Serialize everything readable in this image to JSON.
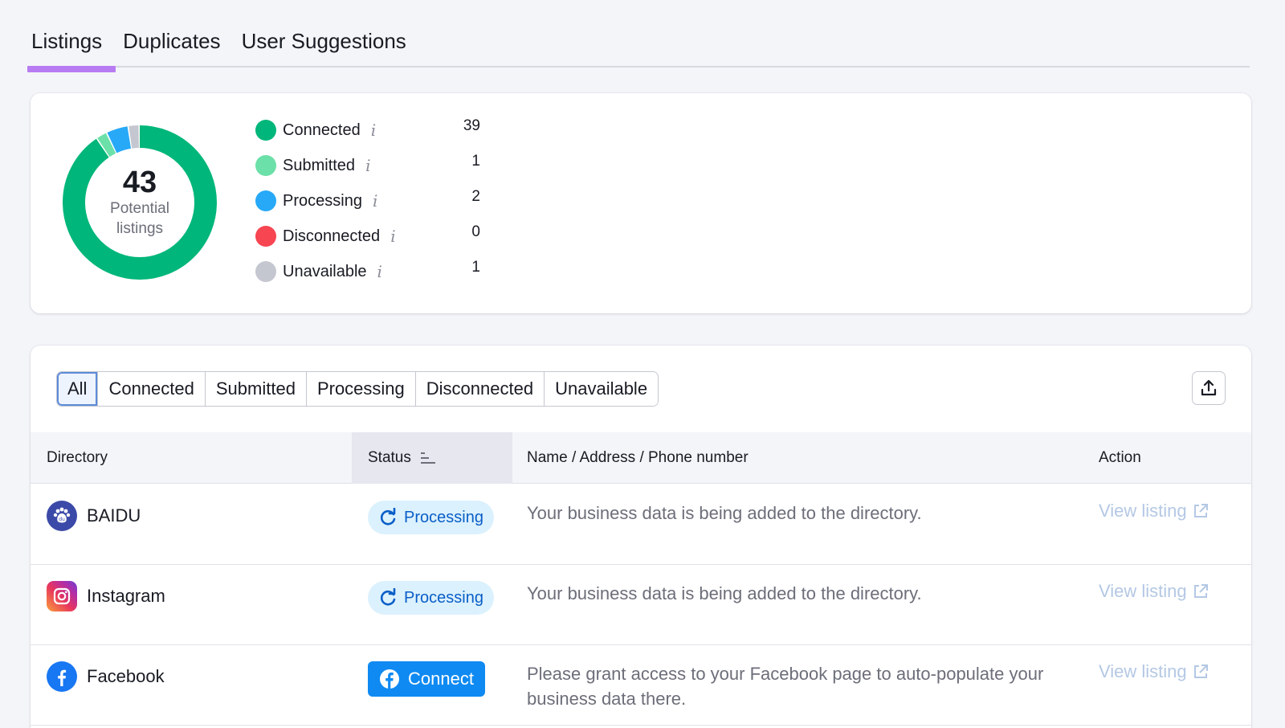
{
  "tabs": [
    {
      "label": "Listings",
      "active": true
    },
    {
      "label": "Duplicates",
      "active": false
    },
    {
      "label": "User Suggestions",
      "active": false
    }
  ],
  "summary": {
    "total": "43",
    "caption": "Potential listings",
    "legend": [
      {
        "label": "Connected",
        "value": "39",
        "color": "#00b67a"
      },
      {
        "label": "Submitted",
        "value": "1",
        "color": "#6be0a8"
      },
      {
        "label": "Processing",
        "value": "2",
        "color": "#27a9f8"
      },
      {
        "label": "Disconnected",
        "value": "0",
        "color": "#f74552"
      },
      {
        "label": "Unavailable",
        "value": "1",
        "color": "#c5c7d0"
      }
    ],
    "info_icon": "info-icon"
  },
  "filters": [
    {
      "label": "All",
      "active": true
    },
    {
      "label": "Connected",
      "active": false
    },
    {
      "label": "Submitted",
      "active": false
    },
    {
      "label": "Processing",
      "active": false
    },
    {
      "label": "Disconnected",
      "active": false
    },
    {
      "label": "Unavailable",
      "active": false
    }
  ],
  "export_icon": "upload-icon",
  "table": {
    "headers": {
      "directory": "Directory",
      "status": "Status",
      "name": "Name / Address / Phone number",
      "action": "Action"
    },
    "rows": [
      {
        "directory": "BAIDU",
        "icon": "baidu-icon",
        "status": "Processing",
        "description": "Your business data is being added to the directory.",
        "action": "View listing"
      },
      {
        "directory": "Instagram",
        "icon": "instagram-icon",
        "status": "Processing",
        "description": "Your business data is being added to the directory.",
        "action": "View listing"
      },
      {
        "directory": "Facebook",
        "icon": "facebook-icon",
        "status": "Connect",
        "description": "Please grant access to your Facebook page to auto-populate your business data there.",
        "action": "View listing"
      }
    ]
  }
}
